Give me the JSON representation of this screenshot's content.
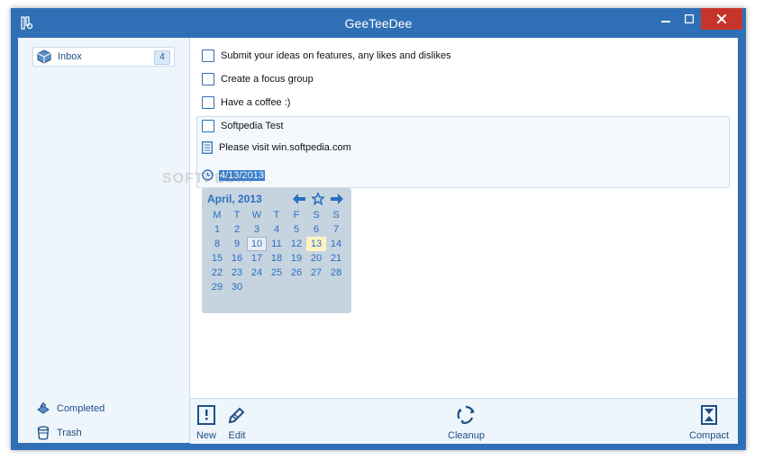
{
  "window": {
    "title": "GeeTeeDee",
    "controls": {
      "minimize": "minimize",
      "maximize": "maximize",
      "close": "close"
    }
  },
  "sidebar": {
    "inbox": {
      "label": "Inbox",
      "count": "4",
      "icon": "box-icon"
    },
    "completed": {
      "label": "Completed",
      "icon": "completed-box-icon"
    },
    "trash": {
      "label": "Trash",
      "icon": "trash-icon"
    }
  },
  "tasks": [
    {
      "text": "Submit your ideas on features, any likes and dislikes",
      "checked": false
    },
    {
      "text": "Create a focus group",
      "checked": false
    },
    {
      "text": "Have a coffee :)",
      "checked": false
    },
    {
      "text": "Softpedia Test",
      "checked": false
    }
  ],
  "selected_task": {
    "note": "Please visit win.softpedia.com",
    "date": "4/13/2013"
  },
  "calendar": {
    "month_label": "April, 2013",
    "weekday_headers": [
      "M",
      "T",
      "W",
      "T",
      "F",
      "S",
      "S"
    ],
    "weeks": [
      [
        "1",
        "2",
        "3",
        "4",
        "5",
        "6",
        "7"
      ],
      [
        "8",
        "9",
        "10",
        "11",
        "12",
        "13",
        "14"
      ],
      [
        "15",
        "16",
        "17",
        "18",
        "19",
        "20",
        "21"
      ],
      [
        "22",
        "23",
        "24",
        "25",
        "26",
        "27",
        "28"
      ],
      [
        "29",
        "30",
        "",
        "",
        "",
        "",
        ""
      ]
    ],
    "selected_day": "10",
    "highlighted_day": "13"
  },
  "toolbar": {
    "new_label": "New",
    "edit_label": "Edit",
    "cleanup_label": "Cleanup",
    "compact_label": "Compact"
  },
  "watermark": "SOFTPEDIA",
  "colors": {
    "accent": "#2f6fb5",
    "close_button": "#c7342b",
    "highlight_day": "#fff4c2",
    "selection": "#3a7fd0"
  }
}
